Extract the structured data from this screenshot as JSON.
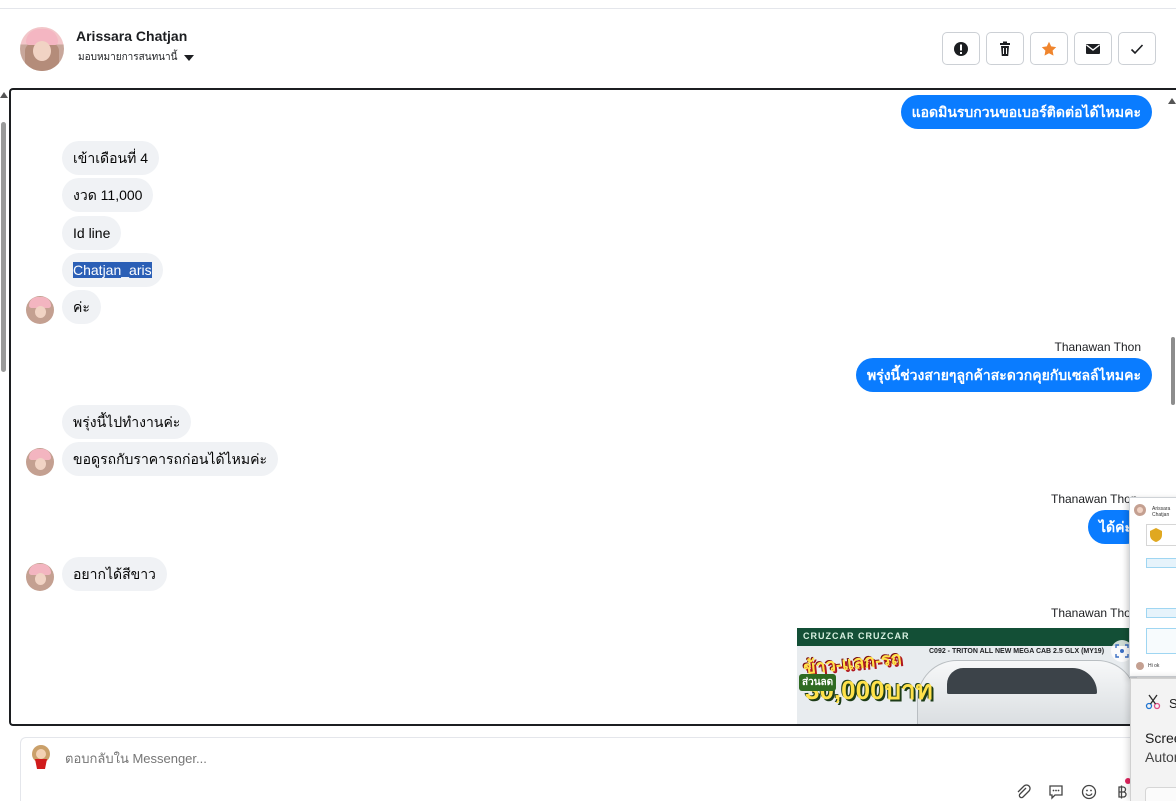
{
  "header": {
    "contact_name": "Arissara Chatjan",
    "assign_label": "มอบหมายการสนทนานี้",
    "actions": [
      "report-icon",
      "trash-icon",
      "star-icon",
      "mail-icon",
      "check-icon"
    ]
  },
  "messages": {
    "out_1": "แอดมินรบกวนขอเบอร์ติดต่อได้ไหมคะ",
    "in_1": "เข้าเดือนที่ 4",
    "in_2": "งวด 11,000",
    "in_3": "Id line",
    "in_4": "Chatjan_aris",
    "in_5": "ค่ะ",
    "sender_1": "Thanawan Thon",
    "out_2": "พรุ่งนี้ช่วงสายๆลูกค้าสะดวกคุยกับเซลล์ไหมคะ",
    "in_6": "พรุ่งนี้ไปทำงานค่ะ",
    "in_7": "ขอดูรถกับราคารถก่อนได้ไหมค่ะ",
    "sender_2": "Thanawan Thon",
    "out_3": "ได้ค่ะ",
    "in_8": "อยากได้สีขาว",
    "sender_3": "Thanawan Thon"
  },
  "ad": {
    "strip_text": "CRUZCAR CRUZCAR",
    "promo_text": "ข้าว-แลก-รถ",
    "discount_label": "ส่วนลด",
    "discount_value": "30,000บาท",
    "model_text": "C092 - TRITON ALL NEW MEGA CAB 2.5 GLX (MY19)"
  },
  "composer": {
    "placeholder": "ตอบกลับใน Messenger..."
  },
  "overlay": {
    "thumb_title": "Arissara Chatjan",
    "thumb_caption": "Hi ok",
    "toast_app": "Sn",
    "toast_line1": "Scree",
    "toast_line2": "Autom"
  },
  "colors": {
    "outgoing_bubble": "#0a7cff",
    "incoming_bubble": "#f0f2f5",
    "selection": "#2b5fb6",
    "star": "#f0852d"
  }
}
